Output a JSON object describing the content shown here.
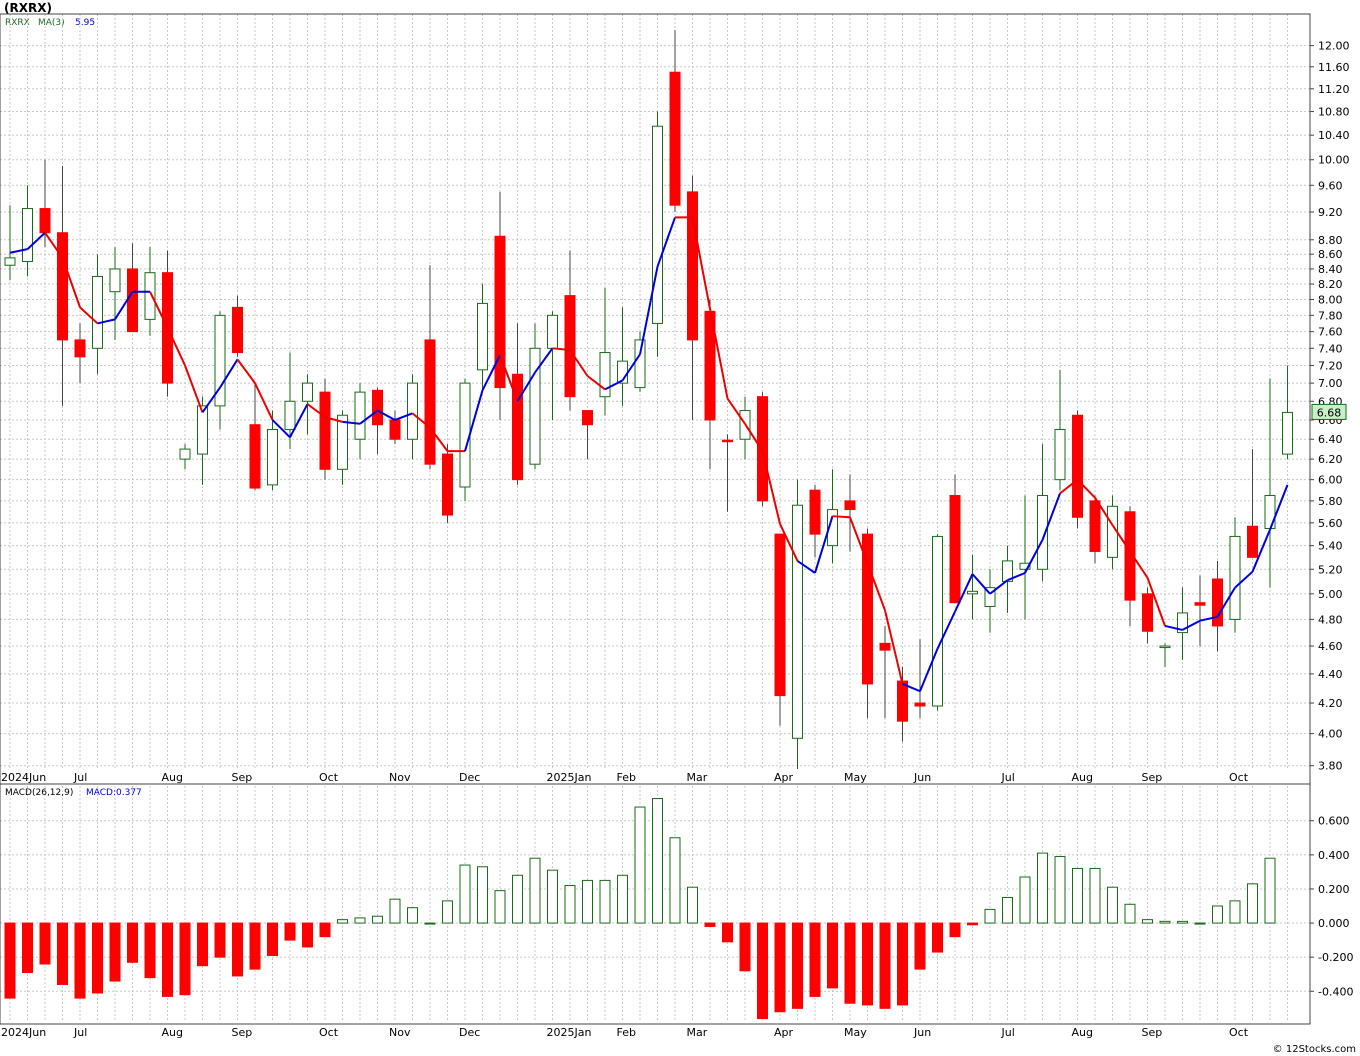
{
  "title": "(RXRX)",
  "watermark": "© 12Stocks.com",
  "colors": {
    "up": "#1a6b1a",
    "down": "#ff0000",
    "ma_up": "#0000dd",
    "ma_down": "#ee0000",
    "grid": "#c8c8c8",
    "bg": "#ffffff",
    "last_bg": "#c8f0c8"
  },
  "chart_data": [
    {
      "type": "candlestick",
      "legend": {
        "symbol": "RXRX",
        "ma_label": "MA(3)",
        "ma_value": "5.95"
      },
      "y_ticks": [
        "3.80",
        "4.00",
        "4.20",
        "4.40",
        "4.60",
        "4.80",
        "5.00",
        "5.20",
        "5.40",
        "5.60",
        "5.80",
        "6.00",
        "6.20",
        "6.40",
        "6.60",
        "6.80",
        "7.00",
        "7.20",
        "7.40",
        "7.60",
        "7.80",
        "8.00",
        "8.20",
        "8.40",
        "8.60",
        "8.80",
        "9.20",
        "9.60",
        "10.00",
        "10.40",
        "10.80",
        "11.20",
        "11.60",
        "12.00"
      ],
      "ylim": [
        3.75,
        12.5
      ],
      "scale": "log",
      "last_price": "6.68",
      "month_labels": [
        {
          "label": "2024Jun",
          "week": 0
        },
        {
          "label": "Jul",
          "week": 4
        },
        {
          "label": "Aug",
          "week": 9
        },
        {
          "label": "Sep",
          "week": 13
        },
        {
          "label": "Oct",
          "week": 18
        },
        {
          "label": "Nov",
          "week": 22
        },
        {
          "label": "Dec",
          "week": 26
        },
        {
          "label": "2025Jan",
          "week": 31
        },
        {
          "label": "Feb",
          "week": 35
        },
        {
          "label": "Mar",
          "week": 39
        },
        {
          "label": "Apr",
          "week": 44
        },
        {
          "label": "May",
          "week": 48
        },
        {
          "label": "Jun",
          "week": 52
        },
        {
          "label": "Jul",
          "week": 57
        },
        {
          "label": "Aug",
          "week": 61
        },
        {
          "label": "Sep",
          "week": 65
        },
        {
          "label": "Oct",
          "week": 70
        }
      ],
      "ohlc": [
        [
          8.45,
          9.3,
          8.25,
          8.55
        ],
        [
          8.5,
          9.6,
          8.3,
          9.25
        ],
        [
          9.25,
          10.0,
          8.7,
          8.9
        ],
        [
          8.9,
          9.9,
          6.75,
          7.5
        ],
        [
          7.5,
          7.7,
          7.0,
          7.3
        ],
        [
          7.4,
          8.6,
          7.1,
          8.3
        ],
        [
          8.1,
          8.7,
          7.5,
          8.4
        ],
        [
          8.4,
          8.75,
          7.6,
          7.6
        ],
        [
          7.75,
          8.7,
          7.55,
          8.35
        ],
        [
          8.35,
          8.65,
          6.85,
          7.0
        ],
        [
          6.2,
          6.35,
          6.1,
          6.3
        ],
        [
          6.25,
          6.85,
          5.95,
          6.75
        ],
        [
          6.75,
          7.85,
          6.5,
          7.8
        ],
        [
          7.9,
          8.05,
          7.3,
          7.35
        ],
        [
          6.55,
          7.0,
          5.9,
          5.92
        ],
        [
          5.95,
          6.7,
          5.9,
          6.5
        ],
        [
          6.5,
          7.35,
          6.3,
          6.8
        ],
        [
          6.8,
          7.1,
          6.45,
          7.0
        ],
        [
          6.9,
          7.05,
          6.0,
          6.1
        ],
        [
          6.1,
          6.7,
          5.95,
          6.65
        ],
        [
          6.4,
          7.0,
          6.2,
          6.9
        ],
        [
          6.92,
          6.95,
          6.25,
          6.55
        ],
        [
          6.6,
          6.7,
          6.35,
          6.4
        ],
        [
          6.4,
          7.1,
          6.2,
          7.0
        ],
        [
          7.5,
          8.45,
          6.1,
          6.15
        ],
        [
          6.25,
          6.35,
          5.6,
          5.67
        ],
        [
          5.93,
          7.05,
          5.8,
          7.0
        ],
        [
          7.15,
          8.2,
          6.9,
          7.95
        ],
        [
          8.85,
          9.5,
          6.6,
          6.95
        ],
        [
          7.1,
          7.7,
          5.95,
          6.0
        ],
        [
          6.15,
          7.7,
          6.1,
          7.4
        ],
        [
          7.4,
          7.85,
          6.6,
          7.8
        ],
        [
          8.05,
          8.65,
          6.7,
          6.85
        ],
        [
          6.7,
          6.7,
          6.2,
          6.55
        ],
        [
          6.85,
          8.15,
          6.65,
          7.35
        ],
        [
          7.0,
          7.9,
          6.75,
          7.25
        ],
        [
          6.95,
          7.6,
          6.9,
          7.5
        ],
        [
          7.7,
          10.8,
          7.3,
          10.55
        ],
        [
          11.5,
          12.3,
          9.2,
          9.3
        ],
        [
          9.5,
          9.75,
          6.6,
          7.5
        ],
        [
          7.85,
          8.0,
          6.1,
          6.6
        ],
        [
          6.39,
          6.45,
          5.7,
          6.38
        ],
        [
          6.4,
          6.85,
          6.2,
          6.7
        ],
        [
          6.85,
          6.9,
          5.75,
          5.8
        ],
        [
          5.5,
          5.5,
          4.05,
          4.25
        ],
        [
          3.97,
          6.0,
          3.78,
          5.76
        ],
        [
          5.9,
          5.95,
          5.3,
          5.5
        ],
        [
          5.4,
          6.1,
          5.25,
          5.72
        ],
        [
          5.8,
          6.05,
          5.35,
          5.72
        ],
        [
          5.5,
          5.55,
          4.1,
          4.33
        ],
        [
          4.62,
          4.75,
          4.1,
          4.57
        ],
        [
          4.35,
          4.45,
          3.95,
          4.08
        ],
        [
          4.2,
          4.65,
          4.1,
          4.18
        ],
        [
          4.18,
          5.5,
          4.15,
          5.48
        ],
        [
          5.85,
          6.05,
          4.95,
          4.93
        ],
        [
          5.0,
          5.32,
          4.8,
          5.02
        ],
        [
          4.9,
          5.2,
          4.7,
          5.05
        ],
        [
          5.1,
          5.4,
          4.85,
          5.27
        ],
        [
          5.2,
          5.85,
          4.8,
          5.25
        ],
        [
          5.2,
          6.35,
          5.1,
          5.85
        ],
        [
          6.0,
          7.15,
          5.9,
          6.5
        ],
        [
          6.65,
          6.7,
          5.55,
          5.65
        ],
        [
          5.8,
          5.85,
          5.25,
          5.35
        ],
        [
          5.3,
          5.85,
          5.2,
          5.75
        ],
        [
          5.7,
          5.75,
          4.75,
          4.95
        ],
        [
          5.0,
          5.05,
          4.62,
          4.71
        ],
        [
          4.6,
          4.62,
          4.45,
          4.6
        ],
        [
          4.7,
          5.05,
          4.5,
          4.85
        ],
        [
          4.93,
          5.15,
          4.6,
          4.91
        ],
        [
          5.12,
          5.27,
          4.56,
          4.75
        ],
        [
          4.8,
          5.65,
          4.7,
          5.48
        ],
        [
          5.57,
          6.3,
          5.3,
          5.3
        ],
        [
          5.55,
          7.05,
          5.05,
          5.85
        ],
        [
          6.25,
          7.2,
          6.2,
          6.68
        ]
      ],
      "ma3": [
        8.62,
        8.67,
        8.9,
        8.55,
        7.9,
        7.7,
        7.75,
        8.1,
        8.1,
        7.65,
        7.2,
        6.68,
        6.95,
        7.27,
        7.0,
        6.6,
        6.42,
        6.77,
        6.63,
        6.58,
        6.56,
        6.7,
        6.6,
        6.67,
        6.52,
        6.28,
        6.28,
        6.92,
        7.32,
        6.8,
        7.12,
        7.4,
        7.38,
        7.08,
        6.93,
        7.03,
        7.33,
        8.43,
        9.12,
        9.12,
        7.88,
        6.83,
        6.56,
        6.28,
        5.59,
        5.27,
        5.17,
        5.66,
        5.65,
        5.25,
        4.87,
        4.33,
        4.28,
        4.58,
        4.86,
        5.16,
        5.0,
        5.11,
        5.17,
        5.45,
        5.87,
        6.0,
        5.83,
        5.58,
        5.35,
        5.13,
        4.75,
        4.72,
        4.79,
        4.82,
        5.05,
        5.18,
        5.54,
        5.95
      ],
      "ma_up_flags": [
        1,
        1,
        1,
        0,
        0,
        0,
        1,
        1,
        1,
        0,
        0,
        0,
        1,
        1,
        0,
        0,
        1,
        1,
        0,
        0,
        1,
        1,
        1,
        1,
        0,
        0,
        0,
        1,
        1,
        0,
        1,
        1,
        0,
        0,
        0,
        1,
        1,
        1,
        1,
        0,
        0,
        0,
        0,
        0,
        0,
        0,
        1,
        1,
        0,
        0,
        0,
        0,
        1,
        1,
        1,
        1,
        1,
        1,
        1,
        1,
        1,
        0,
        0,
        0,
        0,
        0,
        0,
        1,
        1,
        1,
        1,
        1,
        1,
        1
      ]
    },
    {
      "type": "bar",
      "legend": {
        "label": "MACD(26,12,9)",
        "value_label": "MACD:0.377"
      },
      "y_ticks": [
        "-0.400",
        "-0.200",
        "0.000",
        "0.200",
        "0.400",
        "0.600"
      ],
      "ylim": [
        -0.58,
        0.78
      ],
      "values": [
        -0.44,
        -0.29,
        -0.24,
        -0.36,
        -0.44,
        -0.41,
        -0.34,
        -0.23,
        -0.32,
        -0.43,
        -0.42,
        -0.25,
        -0.2,
        -0.31,
        -0.27,
        -0.19,
        -0.1,
        -0.14,
        -0.08,
        0.02,
        0.03,
        0.04,
        0.14,
        0.09,
        0.0,
        0.13,
        0.34,
        0.33,
        0.19,
        0.28,
        0.38,
        0.31,
        0.22,
        0.25,
        0.25,
        0.28,
        0.68,
        0.73,
        0.5,
        0.21,
        -0.02,
        -0.11,
        -0.28,
        -0.56,
        -0.52,
        -0.5,
        -0.43,
        -0.38,
        -0.47,
        -0.48,
        -0.5,
        -0.48,
        -0.27,
        -0.17,
        -0.08,
        -0.01,
        0.08,
        0.15,
        0.27,
        0.41,
        0.39,
        0.32,
        0.32,
        0.21,
        0.11,
        0.02,
        0.01,
        0.01,
        0.0,
        0.1,
        0.13,
        0.23,
        0.38
      ]
    }
  ]
}
